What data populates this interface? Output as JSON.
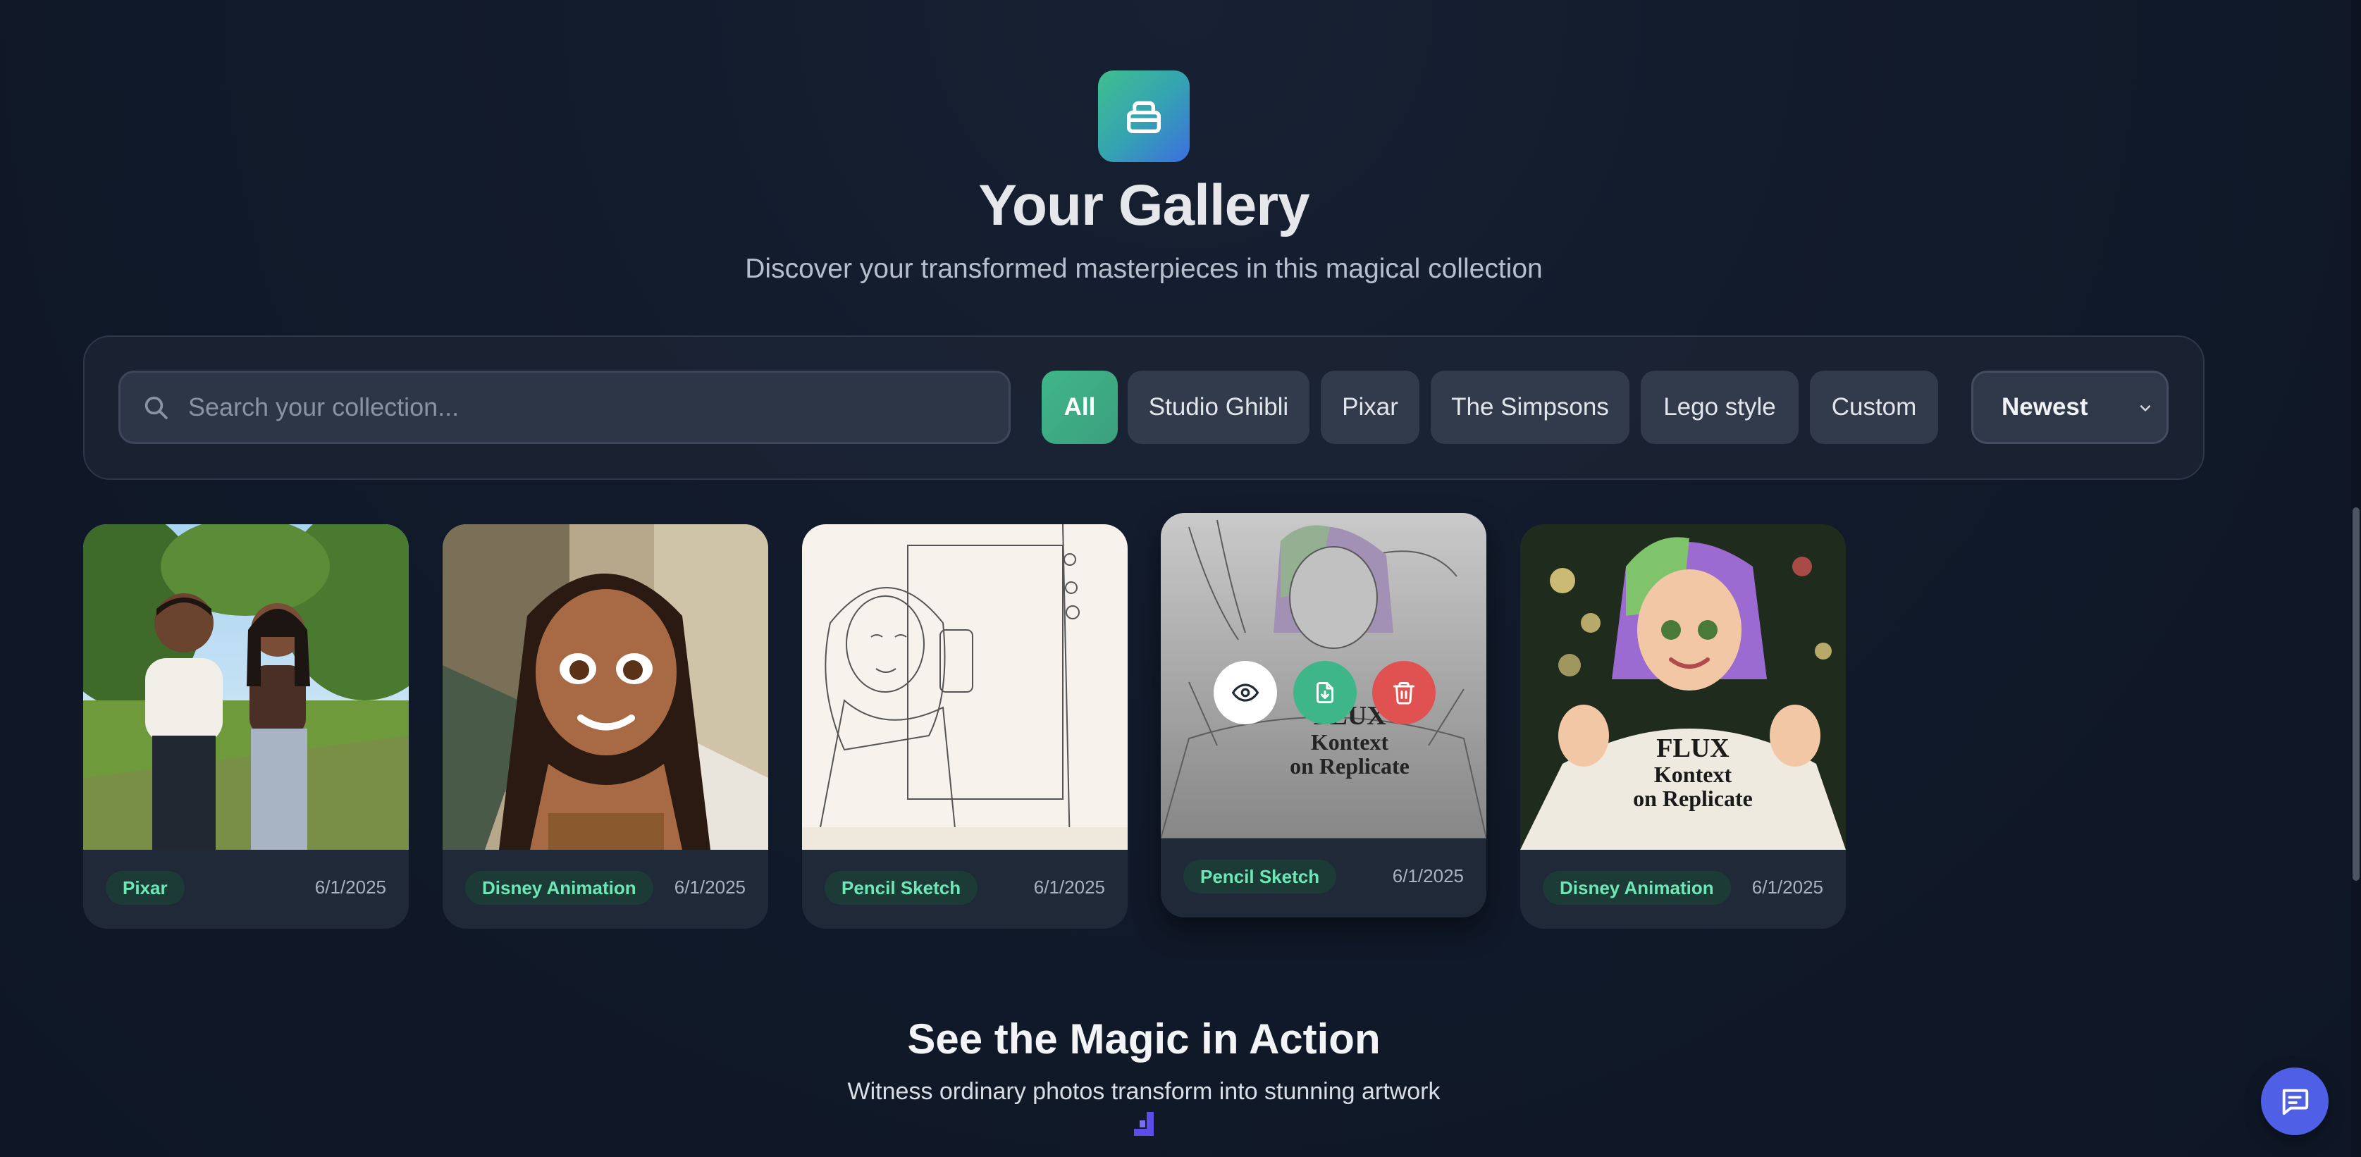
{
  "hero": {
    "icon": "gallery-stack-icon",
    "title": "Your Gallery",
    "subtitle": "Discover your transformed masterpieces in this magical collection"
  },
  "filters": {
    "search_placeholder": "Search your collection...",
    "chips": [
      "All",
      "Studio Ghibli",
      "Pixar",
      "The Simpsons",
      "Lego style",
      "Custom"
    ],
    "active_chip": "All",
    "sort_value": "Newest"
  },
  "cards": [
    {
      "style": "Pixar",
      "date": "6/1/2025",
      "image": "couple-in-park-pixar"
    },
    {
      "style": "Disney Animation",
      "date": "6/1/2025",
      "image": "braided-woman-selfie-disney"
    },
    {
      "style": "Pencil Sketch",
      "date": "6/1/2025",
      "image": "mirror-selfie-pencil-sketch"
    },
    {
      "style": "Pencil Sketch",
      "date": "6/1/2025",
      "image": "flux-kontext-sweatshirt-sketch"
    },
    {
      "style": "Disney Animation",
      "date": "6/1/2025",
      "image": "flux-kontext-sweatshirt-disney"
    }
  ],
  "card_actions": [
    "view-eye-icon",
    "download-icon",
    "trash-icon"
  ],
  "sweatshirt_text": [
    "FLUX",
    "Kontext",
    "on Replicate"
  ],
  "section": {
    "title": "See the Magic in Action",
    "subtitle": "Witness ordinary photos transform into stunning artwork"
  },
  "colors": {
    "accent_green": "#3fb68a",
    "badge_text": "#6ee7b7",
    "danger": "#e05252",
    "chat_button": "#4f5fe6"
  }
}
